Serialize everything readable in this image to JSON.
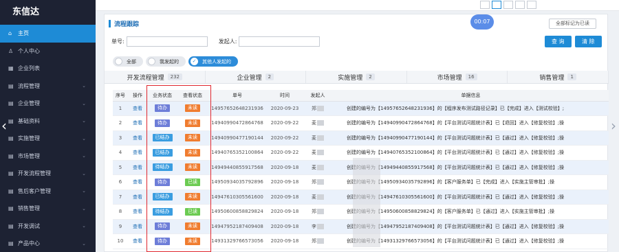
{
  "app": {
    "brand": "东信达"
  },
  "sidebar": {
    "items": [
      {
        "icon": "⌂",
        "label": "主页",
        "active": true,
        "chev": false
      },
      {
        "icon": "♙",
        "label": "个人中心",
        "chev": false
      },
      {
        "icon": "▦",
        "label": "企业列表",
        "chev": false
      },
      {
        "icon": "▤",
        "label": "流程管理",
        "chev": true
      },
      {
        "icon": "▤",
        "label": "企业管理",
        "chev": true
      },
      {
        "icon": "▤",
        "label": "基础资料",
        "chev": true
      },
      {
        "icon": "▤",
        "label": "实施管理",
        "chev": true
      },
      {
        "icon": "▤",
        "label": "市场管理",
        "chev": true
      },
      {
        "icon": "▤",
        "label": "开发流程管理",
        "chev": true
      },
      {
        "icon": "▤",
        "label": "售后客户管理",
        "chev": true
      },
      {
        "icon": "▤",
        "label": "销售管理",
        "chev": true
      },
      {
        "icon": "▤",
        "label": "开发调试",
        "chev": true
      },
      {
        "icon": "▤",
        "label": "产品中心",
        "chev": true
      }
    ]
  },
  "panel": {
    "title": "流程跟踪",
    "mark_all_read": "全部标记为已读",
    "timer": "00:07"
  },
  "filters": {
    "order_no_label": "单号:",
    "initiator_label": "发起人:",
    "query_button": "查 询",
    "clear_button": "清 除"
  },
  "segments": [
    {
      "label": "全部",
      "on": false
    },
    {
      "label": "我发起的",
      "on": false
    },
    {
      "label": "其他人发起的",
      "on": true
    }
  ],
  "tabs": [
    {
      "label": "开发流程管理",
      "count": "232"
    },
    {
      "label": "企业管理",
      "count": "2"
    },
    {
      "label": "实施管理",
      "count": "2"
    },
    {
      "label": "市场管理",
      "count": "16"
    },
    {
      "label": "销售管理",
      "count": "1"
    }
  ],
  "table": {
    "columns": [
      "序号",
      "操作",
      "业务状态",
      "查看状态",
      "单号",
      "时间",
      "发起人",
      "单据信息"
    ],
    "rows": [
      {
        "no": "1",
        "op": "查看",
        "biz": "待办",
        "biz_type": "todo",
        "view": "未读",
        "view_type": "unread",
        "order": "14957652648231936",
        "time": "2020-09-23",
        "initiator": "郑",
        "info": "创建的编号为【14957652648231936】的【程序发布测试路径记录】已【完成】进入【测试校验】;"
      },
      {
        "no": "2",
        "op": "查看",
        "biz": "待办",
        "biz_type": "todo",
        "view": "未读",
        "view_type": "unread",
        "order": "14940990472864768",
        "time": "2020-09-22",
        "initiator": "麦",
        "info": "创建的编号为【14940990472864768】的【平台测试问题统计表】已【退回】进入【修复校验】;操"
      },
      {
        "no": "3",
        "op": "查看",
        "biz": "已结办",
        "biz_type": "done",
        "view": "未读",
        "view_type": "unread",
        "order": "14940990477190144",
        "time": "2020-09-22",
        "initiator": "麦",
        "info": "创建的编号为【14940990477190144】的【平台测试问题统计表】已【通过】进入【修复校验】;操"
      },
      {
        "no": "4",
        "op": "查看",
        "biz": "已结办",
        "biz_type": "done",
        "view": "未读",
        "view_type": "unread",
        "order": "14940765352100864",
        "time": "2020-09-22",
        "initiator": "麦",
        "info": "创建的编号为【14940765352100864】的【平台测试问题统计表】已【通过】进入【修复校验】;操"
      },
      {
        "no": "5",
        "op": "查看",
        "biz": "待结办",
        "biz_type": "done",
        "view": "未读",
        "view_type": "unread",
        "order": "14949440855917568",
        "time": "2020-09-18",
        "initiator": "麦",
        "info": "创建的编号为【14949440855917568】的【平台测试问题统计表】已【通过】进入【修复校验】;操"
      },
      {
        "no": "6",
        "op": "查看",
        "biz": "待办",
        "biz_type": "todo",
        "view": "已读",
        "view_type": "read",
        "order": "14950934035792896",
        "time": "2020-09-18",
        "initiator": "郑",
        "info": "创建的编号为【14950934035792896】的【客户服务单】已【完成】进入【实施主管审批】;操"
      },
      {
        "no": "7",
        "op": "查看",
        "biz": "已结办",
        "biz_type": "done",
        "view": "未读",
        "view_type": "unread",
        "order": "14947610305561600",
        "time": "2020-09-18",
        "initiator": "麦",
        "info": "创建的编号为【14947610305561600】的【平台测试问题统计表】已【通过】进入【修复校验】;操"
      },
      {
        "no": "8",
        "op": "查看",
        "biz": "待结办",
        "biz_type": "done",
        "view": "已读",
        "view_type": "read",
        "order": "14950600858829824",
        "time": "2020-09-18",
        "initiator": "郑",
        "info": "创建的编号为【14950600858829824】的【客户服务单】已【通过】进入【实施主管审批】;操"
      },
      {
        "no": "9",
        "op": "查看",
        "biz": "待办",
        "biz_type": "todo",
        "view": "未读",
        "view_type": "unread",
        "order": "14947952187409408",
        "time": "2020-09-18",
        "initiator": "李",
        "info": "创建的编号为【14947952187409408】的【平台测试问题统计表】已【通过】进入【修复校验】;操"
      },
      {
        "no": "10",
        "op": "查看",
        "biz": "待办",
        "biz_type": "todo",
        "view": "未读",
        "view_type": "unread",
        "order": "14931329766573056",
        "time": "2020-09-18",
        "initiator": "郑",
        "info": "创建的编号为【14931329766573056】的【平台测试问题统计表】已【通过】进入【修复校验】;操"
      }
    ]
  }
}
